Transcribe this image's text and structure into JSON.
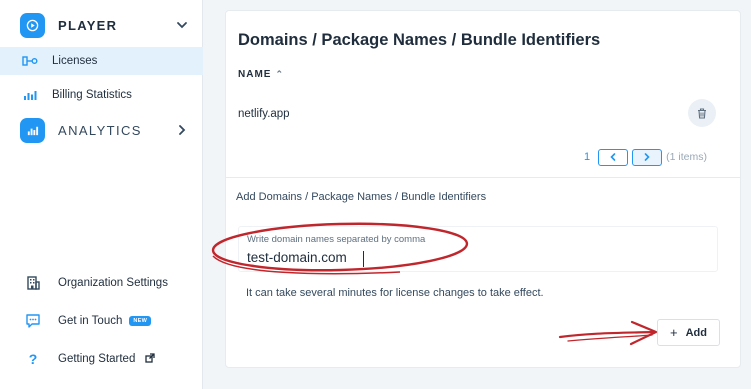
{
  "sidebar": {
    "player_label": "PLAYER",
    "sub_items": [
      {
        "label": "Licenses"
      },
      {
        "label": "Billing Statistics"
      }
    ],
    "analytics_label": "ANALYTICS",
    "bottom_items": [
      {
        "label": "Organization Settings",
        "icon": "building-icon"
      },
      {
        "label": "Get in Touch",
        "icon": "chat-icon",
        "badge": "NEW"
      },
      {
        "label": "Getting Started",
        "icon": "question-icon"
      }
    ]
  },
  "main": {
    "title": "Domains / Package Names / Bundle Identifiers",
    "column_header": "NAME",
    "rows": [
      {
        "name": "netlify.app"
      }
    ],
    "pagination": {
      "page": "1",
      "items_text": "(1 items)"
    },
    "add_section": {
      "title": "Add Domains / Package Names / Bundle Identifiers",
      "input_label": "Write domain names separated by comma",
      "input_value": "test-domain.com",
      "hint": "It can take several minutes for license changes to take effect.",
      "add_button": "Add"
    }
  },
  "colors": {
    "accent": "#2196f3",
    "annotation": "#c0272d"
  }
}
